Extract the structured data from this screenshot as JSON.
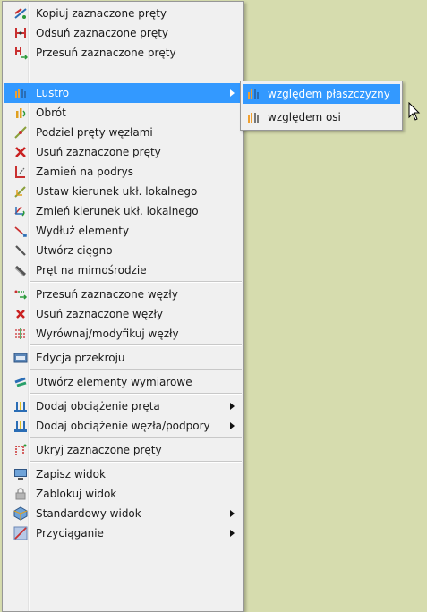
{
  "menu": {
    "items": [
      {
        "label": "Kopiuj zaznaczone pręty",
        "icon": "copy-bars-icon"
      },
      {
        "label": "Odsuń zaznaczone pręty",
        "icon": "offset-bars-icon"
      },
      {
        "label": "Przesuń zaznaczone pręty",
        "icon": "move-bars-icon"
      },
      {
        "label": "Lustro",
        "icon": "mirror-icon"
      },
      {
        "label": "Obrót",
        "icon": "rotate-icon"
      },
      {
        "label": "Podziel pręty węzłami",
        "icon": "split-bars-icon"
      },
      {
        "label": "Usuń zaznaczone pręty",
        "icon": "delete-bars-icon"
      },
      {
        "label": "Zamień na podrys",
        "icon": "convert-underlay-icon"
      },
      {
        "label": "Ustaw kierunek ukł. lokalnego",
        "icon": "set-local-axis-icon"
      },
      {
        "label": "Zmień kierunek ukł. lokalnego",
        "icon": "change-local-axis-icon"
      },
      {
        "label": "Wydłuż elementy",
        "icon": "extend-elements-icon"
      },
      {
        "label": "Utwórz cięgno",
        "icon": "create-tendon-icon"
      },
      {
        "label": "Pręt na mimośrodzie",
        "icon": "eccentric-bar-icon"
      },
      {
        "label": "Przesuń zaznaczone węzły",
        "icon": "move-nodes-icon"
      },
      {
        "label": "Usuń zaznaczone węzły",
        "icon": "delete-nodes-icon"
      },
      {
        "label": "Wyrównaj/modyfikuj węzły",
        "icon": "align-nodes-icon"
      },
      {
        "label": "Edycja przekroju",
        "icon": "section-edit-icon"
      },
      {
        "label": "Utwórz elementy wymiarowe",
        "icon": "dimension-elements-icon"
      },
      {
        "label": "Dodaj obciążenie pręta",
        "icon": "bar-load-icon"
      },
      {
        "label": "Dodaj obciążenie węzła/podpory",
        "icon": "node-load-icon"
      },
      {
        "label": "Ukryj zaznaczone pręty",
        "icon": "hide-bars-icon"
      },
      {
        "label": "Zapisz widok",
        "icon": "save-view-icon"
      },
      {
        "label": "Zablokuj widok",
        "icon": "lock-view-icon"
      },
      {
        "label": "Standardowy widok",
        "icon": "standard-view-icon"
      },
      {
        "label": "Przyciąganie",
        "icon": "snap-icon"
      }
    ]
  },
  "submenu": {
    "items": [
      {
        "label": "względem płaszczyzny",
        "icon": "mirror-plane-icon"
      },
      {
        "label": "względem osi",
        "icon": "mirror-axis-icon"
      }
    ]
  },
  "colors": {
    "highlight": "#3399ff",
    "background": "#d6dcae",
    "menu": "#f0f0f0"
  },
  "cursor": {
    "icon": "mouse-pointer-icon"
  }
}
